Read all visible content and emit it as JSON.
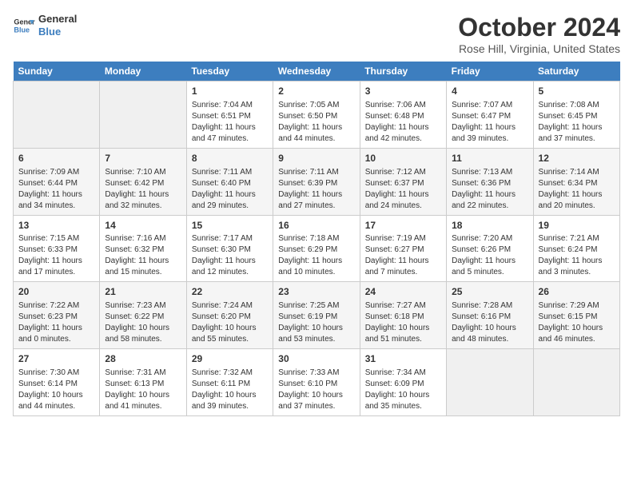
{
  "logo": {
    "line1": "General",
    "line2": "Blue"
  },
  "title": "October 2024",
  "location": "Rose Hill, Virginia, United States",
  "columns": [
    "Sunday",
    "Monday",
    "Tuesday",
    "Wednesday",
    "Thursday",
    "Friday",
    "Saturday"
  ],
  "weeks": [
    [
      {
        "empty": true
      },
      {
        "empty": true
      },
      {
        "day": "1",
        "sunrise": "Sunrise: 7:04 AM",
        "sunset": "Sunset: 6:51 PM",
        "daylight": "Daylight: 11 hours and 47 minutes."
      },
      {
        "day": "2",
        "sunrise": "Sunrise: 7:05 AM",
        "sunset": "Sunset: 6:50 PM",
        "daylight": "Daylight: 11 hours and 44 minutes."
      },
      {
        "day": "3",
        "sunrise": "Sunrise: 7:06 AM",
        "sunset": "Sunset: 6:48 PM",
        "daylight": "Daylight: 11 hours and 42 minutes."
      },
      {
        "day": "4",
        "sunrise": "Sunrise: 7:07 AM",
        "sunset": "Sunset: 6:47 PM",
        "daylight": "Daylight: 11 hours and 39 minutes."
      },
      {
        "day": "5",
        "sunrise": "Sunrise: 7:08 AM",
        "sunset": "Sunset: 6:45 PM",
        "daylight": "Daylight: 11 hours and 37 minutes."
      }
    ],
    [
      {
        "day": "6",
        "sunrise": "Sunrise: 7:09 AM",
        "sunset": "Sunset: 6:44 PM",
        "daylight": "Daylight: 11 hours and 34 minutes."
      },
      {
        "day": "7",
        "sunrise": "Sunrise: 7:10 AM",
        "sunset": "Sunset: 6:42 PM",
        "daylight": "Daylight: 11 hours and 32 minutes."
      },
      {
        "day": "8",
        "sunrise": "Sunrise: 7:11 AM",
        "sunset": "Sunset: 6:40 PM",
        "daylight": "Daylight: 11 hours and 29 minutes."
      },
      {
        "day": "9",
        "sunrise": "Sunrise: 7:11 AM",
        "sunset": "Sunset: 6:39 PM",
        "daylight": "Daylight: 11 hours and 27 minutes."
      },
      {
        "day": "10",
        "sunrise": "Sunrise: 7:12 AM",
        "sunset": "Sunset: 6:37 PM",
        "daylight": "Daylight: 11 hours and 24 minutes."
      },
      {
        "day": "11",
        "sunrise": "Sunrise: 7:13 AM",
        "sunset": "Sunset: 6:36 PM",
        "daylight": "Daylight: 11 hours and 22 minutes."
      },
      {
        "day": "12",
        "sunrise": "Sunrise: 7:14 AM",
        "sunset": "Sunset: 6:34 PM",
        "daylight": "Daylight: 11 hours and 20 minutes."
      }
    ],
    [
      {
        "day": "13",
        "sunrise": "Sunrise: 7:15 AM",
        "sunset": "Sunset: 6:33 PM",
        "daylight": "Daylight: 11 hours and 17 minutes."
      },
      {
        "day": "14",
        "sunrise": "Sunrise: 7:16 AM",
        "sunset": "Sunset: 6:32 PM",
        "daylight": "Daylight: 11 hours and 15 minutes."
      },
      {
        "day": "15",
        "sunrise": "Sunrise: 7:17 AM",
        "sunset": "Sunset: 6:30 PM",
        "daylight": "Daylight: 11 hours and 12 minutes."
      },
      {
        "day": "16",
        "sunrise": "Sunrise: 7:18 AM",
        "sunset": "Sunset: 6:29 PM",
        "daylight": "Daylight: 11 hours and 10 minutes."
      },
      {
        "day": "17",
        "sunrise": "Sunrise: 7:19 AM",
        "sunset": "Sunset: 6:27 PM",
        "daylight": "Daylight: 11 hours and 7 minutes."
      },
      {
        "day": "18",
        "sunrise": "Sunrise: 7:20 AM",
        "sunset": "Sunset: 6:26 PM",
        "daylight": "Daylight: 11 hours and 5 minutes."
      },
      {
        "day": "19",
        "sunrise": "Sunrise: 7:21 AM",
        "sunset": "Sunset: 6:24 PM",
        "daylight": "Daylight: 11 hours and 3 minutes."
      }
    ],
    [
      {
        "day": "20",
        "sunrise": "Sunrise: 7:22 AM",
        "sunset": "Sunset: 6:23 PM",
        "daylight": "Daylight: 11 hours and 0 minutes."
      },
      {
        "day": "21",
        "sunrise": "Sunrise: 7:23 AM",
        "sunset": "Sunset: 6:22 PM",
        "daylight": "Daylight: 10 hours and 58 minutes."
      },
      {
        "day": "22",
        "sunrise": "Sunrise: 7:24 AM",
        "sunset": "Sunset: 6:20 PM",
        "daylight": "Daylight: 10 hours and 55 minutes."
      },
      {
        "day": "23",
        "sunrise": "Sunrise: 7:25 AM",
        "sunset": "Sunset: 6:19 PM",
        "daylight": "Daylight: 10 hours and 53 minutes."
      },
      {
        "day": "24",
        "sunrise": "Sunrise: 7:27 AM",
        "sunset": "Sunset: 6:18 PM",
        "daylight": "Daylight: 10 hours and 51 minutes."
      },
      {
        "day": "25",
        "sunrise": "Sunrise: 7:28 AM",
        "sunset": "Sunset: 6:16 PM",
        "daylight": "Daylight: 10 hours and 48 minutes."
      },
      {
        "day": "26",
        "sunrise": "Sunrise: 7:29 AM",
        "sunset": "Sunset: 6:15 PM",
        "daylight": "Daylight: 10 hours and 46 minutes."
      }
    ],
    [
      {
        "day": "27",
        "sunrise": "Sunrise: 7:30 AM",
        "sunset": "Sunset: 6:14 PM",
        "daylight": "Daylight: 10 hours and 44 minutes."
      },
      {
        "day": "28",
        "sunrise": "Sunrise: 7:31 AM",
        "sunset": "Sunset: 6:13 PM",
        "daylight": "Daylight: 10 hours and 41 minutes."
      },
      {
        "day": "29",
        "sunrise": "Sunrise: 7:32 AM",
        "sunset": "Sunset: 6:11 PM",
        "daylight": "Daylight: 10 hours and 39 minutes."
      },
      {
        "day": "30",
        "sunrise": "Sunrise: 7:33 AM",
        "sunset": "Sunset: 6:10 PM",
        "daylight": "Daylight: 10 hours and 37 minutes."
      },
      {
        "day": "31",
        "sunrise": "Sunrise: 7:34 AM",
        "sunset": "Sunset: 6:09 PM",
        "daylight": "Daylight: 10 hours and 35 minutes."
      },
      {
        "empty": true
      },
      {
        "empty": true
      }
    ]
  ]
}
